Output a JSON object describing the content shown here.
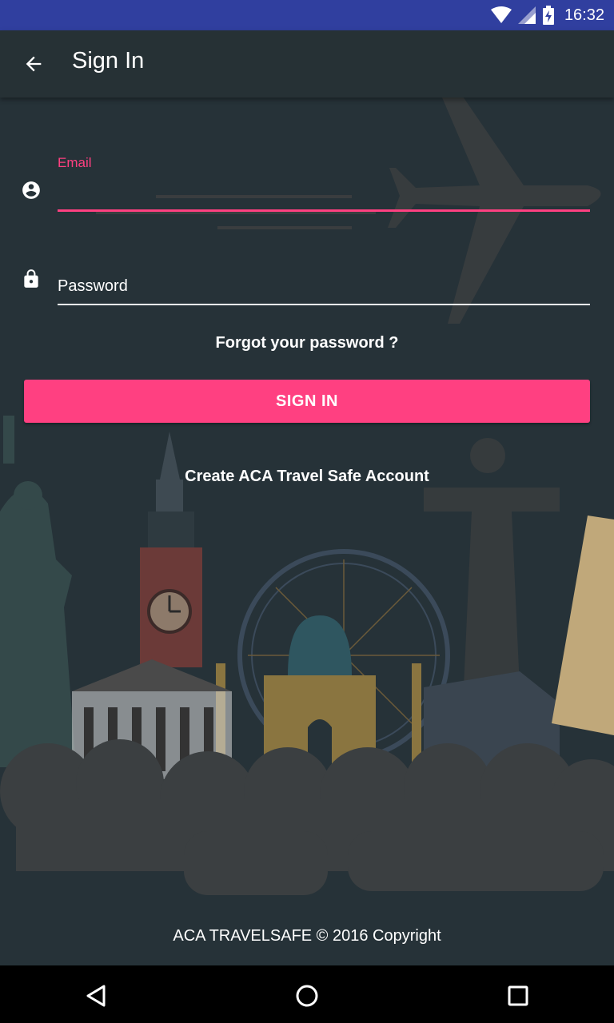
{
  "status_bar": {
    "time": "16:32",
    "icons": [
      "wifi-icon",
      "signal-icon",
      "battery-charging-icon"
    ]
  },
  "app_bar": {
    "title": "Sign In",
    "back_icon": "arrow-back-icon"
  },
  "form": {
    "email": {
      "label": "Email",
      "value": "",
      "icon": "account-circle-icon"
    },
    "password": {
      "placeholder": "Password",
      "value": "",
      "icon": "lock-icon"
    },
    "forgot_label": "Forgot your password ?",
    "signin_label": "SIGN IN",
    "create_account_label": "Create ACA Travel Safe Account"
  },
  "footer": {
    "text": "ACA TRAVELSAFE © 2016 Copyright"
  },
  "nav_bar": {
    "icons": [
      "back-triangle-icon",
      "home-circle-icon",
      "recents-square-icon"
    ]
  },
  "colors": {
    "accent": "#ff4081",
    "background": "#263238",
    "status_bar": "#303f9f",
    "app_bar": "#263135"
  }
}
